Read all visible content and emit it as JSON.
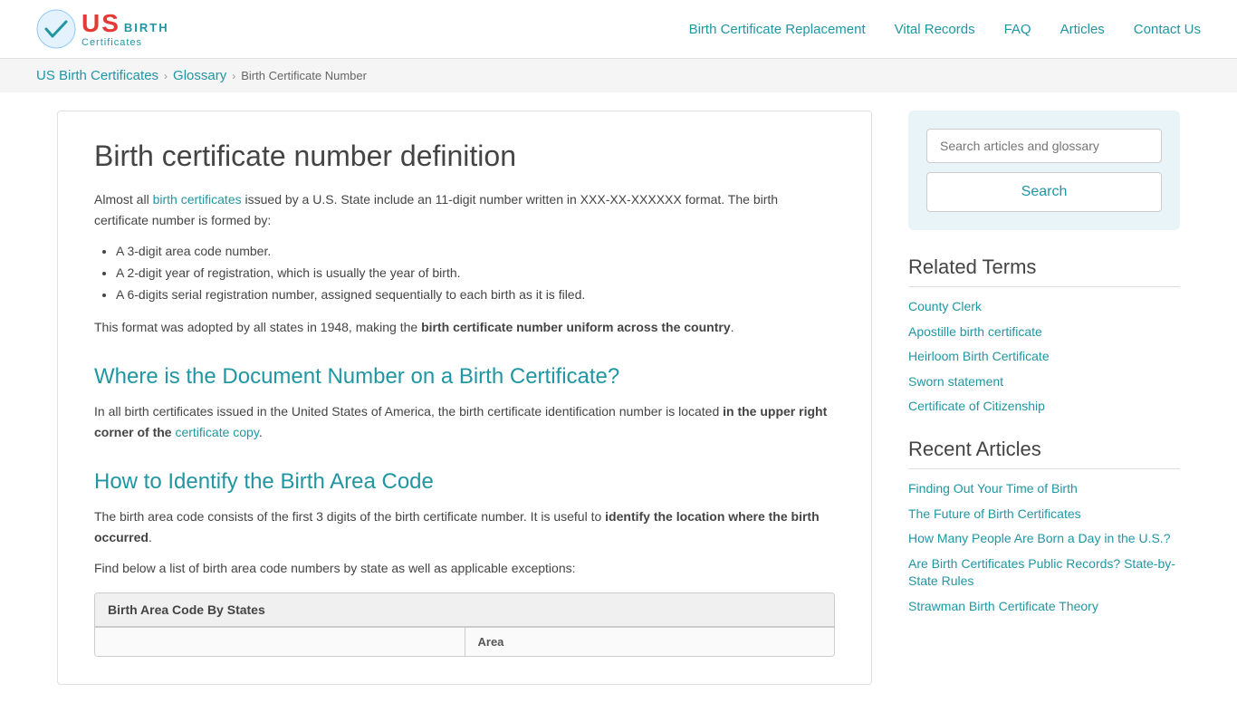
{
  "header": {
    "logo": {
      "us_text": "US",
      "birth_text": "BIRTH",
      "certificates_text": "Certificates"
    },
    "nav": {
      "items": [
        {
          "label": "Birth Certificate Replacement",
          "href": "#"
        },
        {
          "label": "Vital Records",
          "href": "#"
        },
        {
          "label": "FAQ",
          "href": "#"
        },
        {
          "label": "Articles",
          "href": "#"
        },
        {
          "label": "Contact Us",
          "href": "#"
        }
      ]
    }
  },
  "breadcrumb": {
    "items": [
      {
        "label": "US Birth Certificates",
        "href": "#"
      },
      {
        "label": "Glossary",
        "href": "#"
      },
      {
        "label": "Birth Certificate Number",
        "href": "#",
        "current": true
      }
    ]
  },
  "main": {
    "title": "Birth certificate number definition",
    "intro": "Almost all ",
    "intro_link": "birth certificates",
    "intro_rest": " issued by a U.S. State include an 11-digit number written in XXX-XX-XXXXXX format. The birth certificate number is formed by:",
    "bullet_points": [
      "A 3-digit area code number.",
      "A 2-digit year of registration, which is usually the year of birth.",
      "A 6-digits serial registration number, assigned sequentially to each birth as it is filed."
    ],
    "format_note_prefix": "This format was adopted by all states in 1948, making the ",
    "format_note_bold": "birth certificate number uniform across the country",
    "format_note_suffix": ".",
    "section2_title": "Where is the Document Number on a Birth Certificate?",
    "section2_text_prefix": "In all birth certificates issued in the United States of America, the birth certificate identification number is located ",
    "section2_bold": "in the upper right corner of the ",
    "section2_link": "certificate copy",
    "section2_suffix": ".",
    "section3_title": "How to Identify the Birth Area Code",
    "section3_text": "The birth area code consists of the first 3 digits of the birth certificate number. It is useful to ",
    "section3_bold": "identify the location where the birth occurred",
    "section3_suffix": ".",
    "section3_text2": "Find below a list of birth area code numbers by state as well as applicable exceptions:",
    "table": {
      "header": "Birth Area Code By States",
      "columns": [
        "",
        "Area"
      ]
    }
  },
  "sidebar": {
    "search": {
      "placeholder": "Search articles and glossary",
      "button_label": "Search"
    },
    "related_terms": {
      "title": "Related Terms",
      "items": [
        {
          "label": "County Clerk",
          "href": "#"
        },
        {
          "label": "Apostille birth certificate",
          "href": "#"
        },
        {
          "label": "Heirloom Birth Certificate",
          "href": "#"
        },
        {
          "label": "Sworn statement",
          "href": "#"
        },
        {
          "label": "Certificate of Citizenship",
          "href": "#"
        }
      ]
    },
    "recent_articles": {
      "title": "Recent Articles",
      "items": [
        {
          "label": "Finding Out Your Time of Birth",
          "href": "#"
        },
        {
          "label": "The Future of Birth Certificates",
          "href": "#"
        },
        {
          "label": "How Many People Are Born a Day in the U.S.?",
          "href": "#"
        },
        {
          "label": "Are Birth Certificates Public Records? State-by-State Rules",
          "href": "#"
        },
        {
          "label": "Strawman Birth Certificate Theory",
          "href": "#"
        }
      ]
    }
  }
}
